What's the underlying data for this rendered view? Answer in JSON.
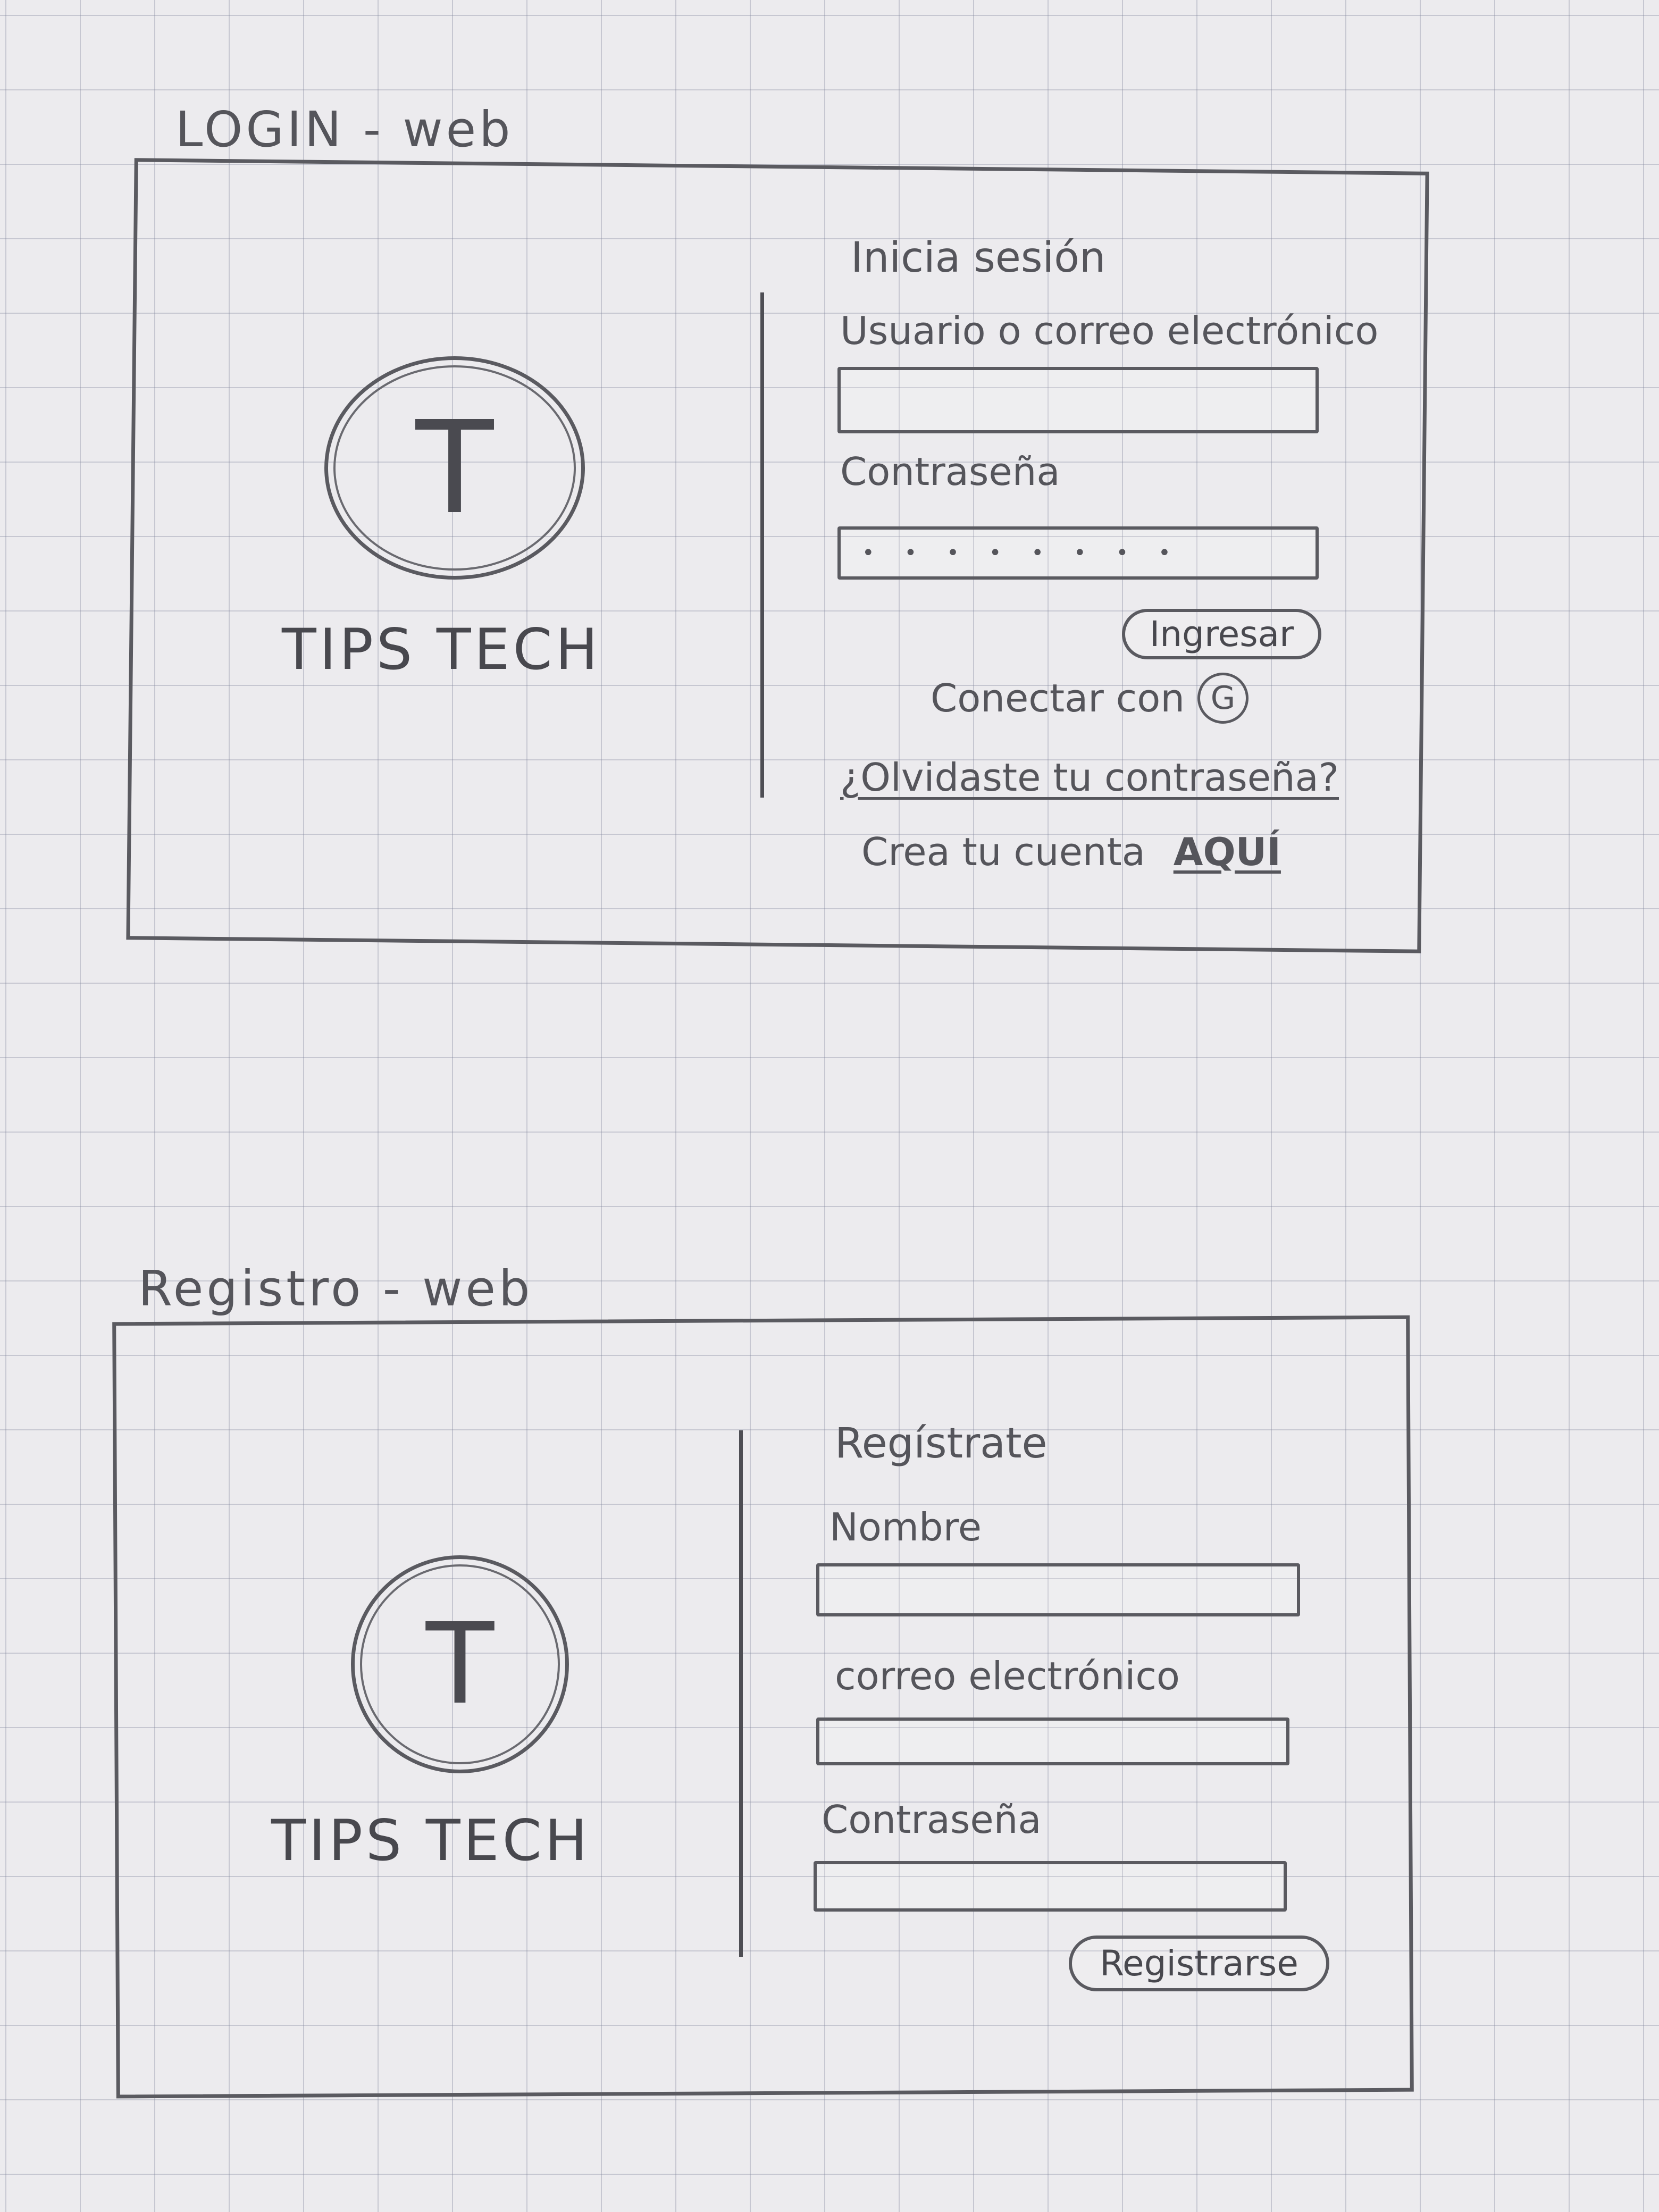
{
  "login": {
    "section_title": "LOGIN - web",
    "brand_letter": "T",
    "brand_name": "TIPS TECH",
    "heading": "Inicia sesión",
    "username_label": "Usuario o correo electrónico",
    "password_label": "Contraseña",
    "password_value": "••••••••",
    "submit_label": "Ingresar",
    "connect_label": "Conectar con",
    "google_letter": "G",
    "forgot_link": "¿Olvidaste tu contraseña?",
    "create_prefix": "Crea tu cuenta",
    "create_link": "AQUÍ"
  },
  "register": {
    "section_title": "Registro - web",
    "brand_letter": "T",
    "brand_name": "TIPS TECH",
    "heading": "Regístrate",
    "name_label": "Nombre",
    "email_label": "correo electrónico",
    "password_label": "Contraseña",
    "submit_label": "Registrarse"
  }
}
